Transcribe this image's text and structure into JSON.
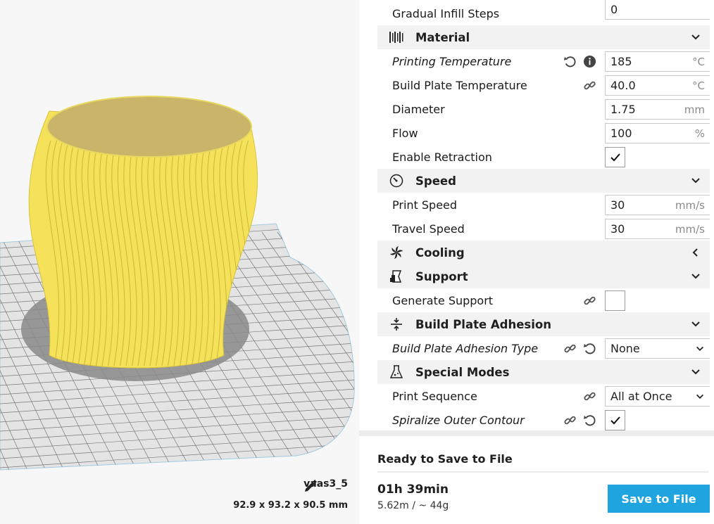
{
  "model": {
    "name": "vaas3_5",
    "dimensions": "92.9 x 93.2 x 90.5 mm"
  },
  "colors": {
    "accent": "#1fa4e0",
    "model": "#f6e25a",
    "model_top": "#c9b46a",
    "category_bg": "#f2f2f2"
  },
  "settings": {
    "gradual_infill_steps": {
      "label": "Gradual Infill Steps",
      "value": "0"
    },
    "material": {
      "label": "Material",
      "icon": "material-icon"
    },
    "printing_temperature": {
      "label": "Printing Temperature",
      "value": "185",
      "unit": "°C"
    },
    "build_plate_temperature": {
      "label": "Build Plate Temperature",
      "value": "40.0",
      "unit": "°C"
    },
    "diameter": {
      "label": "Diameter",
      "value": "1.75",
      "unit": "mm"
    },
    "flow": {
      "label": "Flow",
      "value": "100",
      "unit": "%"
    },
    "enable_retraction": {
      "label": "Enable Retraction",
      "checked": true
    },
    "speed": {
      "label": "Speed",
      "icon": "speedometer-icon"
    },
    "print_speed": {
      "label": "Print Speed",
      "value": "30",
      "unit": "mm/s"
    },
    "travel_speed": {
      "label": "Travel Speed",
      "value": "30",
      "unit": "mm/s"
    },
    "cooling": {
      "label": "Cooling",
      "icon": "fan-icon",
      "collapsed": true
    },
    "support": {
      "label": "Support",
      "icon": "support-icon"
    },
    "generate_support": {
      "label": "Generate Support",
      "checked": false
    },
    "adhesion": {
      "label": "Build Plate Adhesion",
      "icon": "adhesion-icon"
    },
    "adhesion_type": {
      "label": "Build Plate Adhesion Type",
      "value": "None"
    },
    "special_modes": {
      "label": "Special Modes",
      "icon": "flask-icon"
    },
    "print_sequence": {
      "label": "Print Sequence",
      "value": "All at Once"
    },
    "spiralize": {
      "label": "Spiralize Outer Contour",
      "checked": true
    }
  },
  "job": {
    "status": "Ready to Save to File",
    "time": "01h 39min",
    "material": "5.62m / ~ 44g",
    "save_label": "Save to File"
  }
}
